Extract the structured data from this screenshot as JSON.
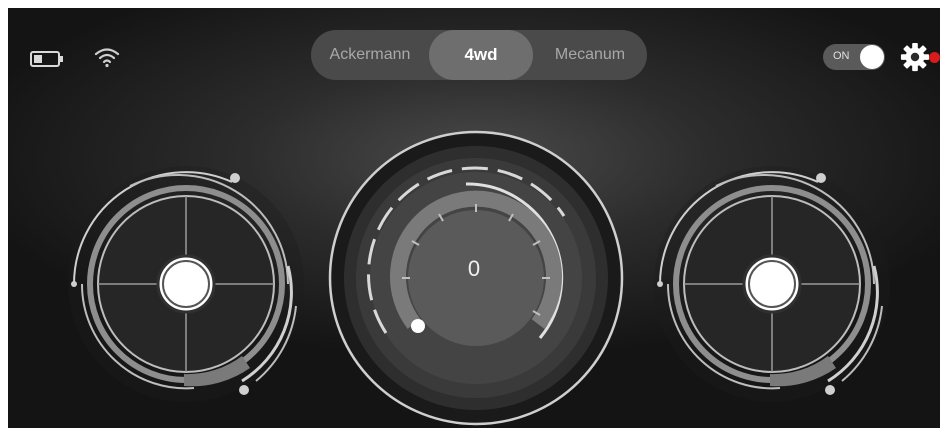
{
  "status_bar": {
    "battery_icon": "battery-icon",
    "wifi_icon": "wifi-icon"
  },
  "modes": {
    "items": [
      "Ackermann",
      "4wd",
      "Mecanum"
    ],
    "selected": "4wd"
  },
  "power_toggle": {
    "label": "ON",
    "state": true
  },
  "settings": {
    "icon": "gear-icon",
    "notification_color": "#d81b1b"
  },
  "speed_dial": {
    "value": "0"
  },
  "colors": {
    "background": "#2c2c2c",
    "selected_mode_bg": "#6e6e6e",
    "mode_bar_bg": "#4a4a4a",
    "accent": "#ffffff",
    "notification": "#d81b1b"
  }
}
